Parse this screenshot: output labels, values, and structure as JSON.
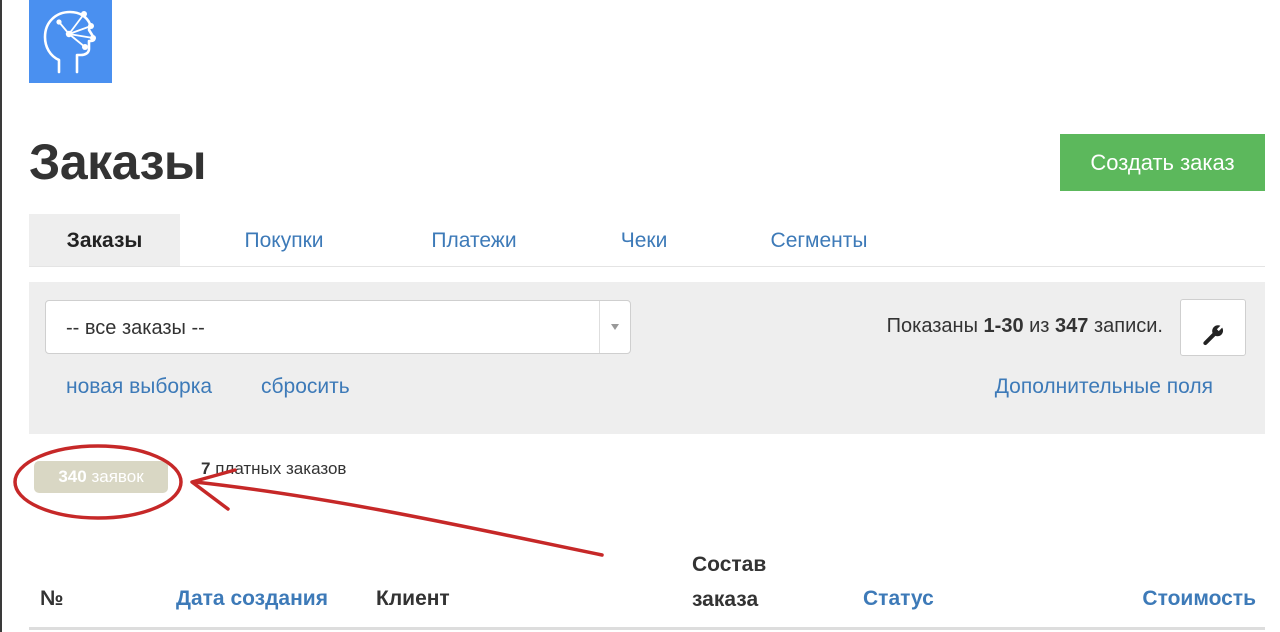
{
  "header": {
    "title": "Заказы",
    "create_button": "Создать заказ",
    "logo_icon": "head-network-icon"
  },
  "tabs": [
    {
      "label": "Заказы",
      "active": true
    },
    {
      "label": "Покупки",
      "active": false
    },
    {
      "label": "Платежи",
      "active": false
    },
    {
      "label": "Чеки",
      "active": false
    },
    {
      "label": "Сегменты",
      "active": false
    }
  ],
  "filter": {
    "selected": "-- все заказы --",
    "shown_prefix": "Показаны ",
    "shown_range": "1-30",
    "shown_mid": " из ",
    "shown_total": "347",
    "shown_suffix": " записи.",
    "settings_icon": "wrench-icon",
    "new_selection": "новая выборка",
    "reset": "сбросить",
    "extra_fields": "Дополнительные поля"
  },
  "stats": {
    "requests_count": "340",
    "requests_label": " заявок",
    "paid_count": "7",
    "paid_label": " платных заказов"
  },
  "table": {
    "columns": [
      {
        "label": "№"
      },
      {
        "label": "Дата создания"
      },
      {
        "label": "Клиент"
      },
      {
        "label_line1": "Состав",
        "label_line2": "заказа"
      },
      {
        "label": "Статус"
      },
      {
        "label": "Стоимость"
      }
    ]
  },
  "colors": {
    "accent": "#3d7ab8",
    "create_button": "#5cb85c",
    "logo": "#4a90f0",
    "annotation": "#c62828",
    "badge": "#d9d7c4"
  }
}
